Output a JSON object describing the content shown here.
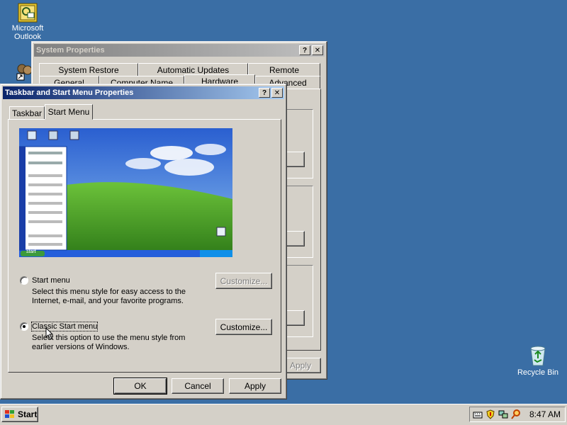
{
  "desktop": {
    "icons": [
      {
        "label": "Microsoft Outlook"
      },
      {
        "label": "Recycle Bin"
      }
    ]
  },
  "system_properties": {
    "title": "System Properties",
    "tabs_back": [
      "System Restore",
      "Automatic Updates",
      "Remote"
    ],
    "tabs_front": [
      "General",
      "Computer Name",
      "Hardware",
      "Advanced"
    ],
    "apply_label": "Apply"
  },
  "taskbar_properties": {
    "title": "Taskbar and Start Menu Properties",
    "help_label": "?",
    "close_label": "✕",
    "tabs": [
      "Taskbar",
      "Start Menu"
    ],
    "active_tab": "Start Menu",
    "preview": {
      "start_label": "start"
    },
    "options": [
      {
        "label": "Start menu",
        "description": [
          "Select this menu style for easy access to the",
          "Internet, e-mail, and your favorite programs."
        ],
        "checked": false,
        "customize_label": "Customize...",
        "customize_enabled": false
      },
      {
        "label": "Classic Start menu",
        "description": [
          "Select this option to use the menu style from",
          "earlier versions of Windows."
        ],
        "checked": true,
        "customize_label": "Customize...",
        "customize_enabled": true
      }
    ],
    "buttons": {
      "ok": "OK",
      "cancel": "Cancel",
      "apply": "Apply"
    }
  },
  "taskbar": {
    "start_label": "Start",
    "clock": "8:47 AM"
  },
  "colors": {
    "desktop": "#3a6ea5",
    "active_title": "#0a246a",
    "face": "#d4d0c8"
  }
}
